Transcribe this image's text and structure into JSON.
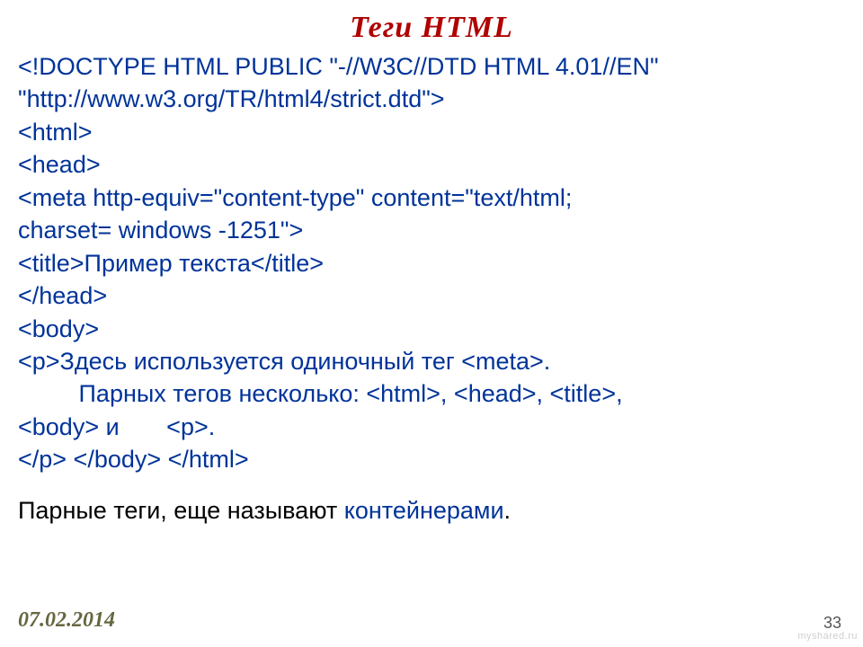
{
  "title": "Теги HTML",
  "code": {
    "l1": "<!DOCTYPE HTML PUBLIC \"-//W3C//DTD HTML 4.01//EN\"",
    "l2": "\"http://www.w3.org/TR/html4/strict.dtd\">",
    "l3": "<html>",
    "l4": "<head>",
    "l5": "<meta http-equiv=\"content-type\" content=\"text/html;",
    "l6": "charset= windows -1251\">",
    "l7": "<title>Пример текста</title>",
    "l8": "</head>",
    "l9": "<body>",
    "l10": "<p>Здесь используется одиночный тег <meta>.",
    "l11": "         Парных тегов несколько: <html>, <head>, <title>,",
    "l12": "<body> и       <p>.",
    "l13": "</p> </body> </html>"
  },
  "footnote": {
    "part1": "Парные теги, еще называют  ",
    "part2": "контейнерами",
    "part3": "."
  },
  "date": "07.02.2014",
  "page": "33",
  "watermark": "myshared.ru"
}
